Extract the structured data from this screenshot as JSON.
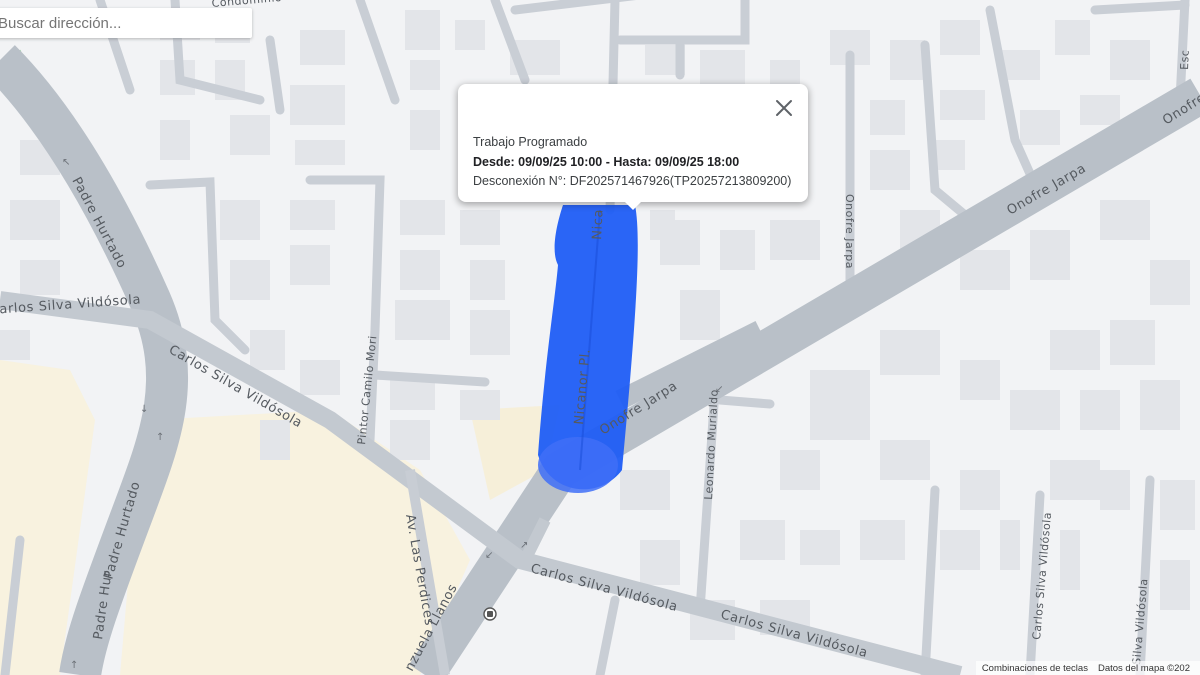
{
  "search": {
    "placeholder": "Buscar dirección..."
  },
  "popup": {
    "title": "Trabajo Programado",
    "schedule": "Desde: 09/09/25 10:00 - Hasta: 09/09/25 18:00",
    "disconnection": "Desconexión N°: DF202571467926(TP20257213809200)",
    "close_icon": "close-icon"
  },
  "map": {
    "colors": {
      "background": "#f2f3f5",
      "road": "#c8cdd3",
      "road_major": "#b9c0c8",
      "building": "#e4e6ea",
      "park": "#f7f0dc",
      "outage_area": "#1f5df5"
    },
    "streets": {
      "padre_hurtado_1": "Padre Hurtado",
      "padre_hurtado_2": "Padre Hurtado",
      "padre_hurtado_3": "Padre Hur",
      "carlos_silva_1": "Carlos Silva Vildósola",
      "carlos_silva_2": "Carlos Silva Vildósola",
      "carlos_silva_3": "Carlos Silva Vildósola",
      "carlos_silva_4": "Carlos Silva Vildósola",
      "carlos_silva_5": "Carlos Silva Vildósola",
      "carlos_silva_6": "Silva Vildósola",
      "onofre_jarpa_1": "Onofre Jarpa",
      "onofre_jarpa_2": "Onofre Jarpa",
      "onofre_jarpa_3": "Onofre Jarpa",
      "onofre_jarpa_4": "Onofre",
      "nicanor_1": "Nicanor Pl.",
      "nicanor_2": "Nica",
      "pintor_camilo_mori": "Pintor Camilo Mori",
      "leonardo_murialdo": "Leonardo Murialdo",
      "las_perdices": "Av. Las Perdices",
      "valenzuela_llanos": "nzuela Llanos",
      "condominio": "Condominio",
      "esc": "Esc"
    }
  },
  "attribution": {
    "shortcuts": "Combinaciones de teclas",
    "map_data": "Datos del mapa ©202"
  }
}
